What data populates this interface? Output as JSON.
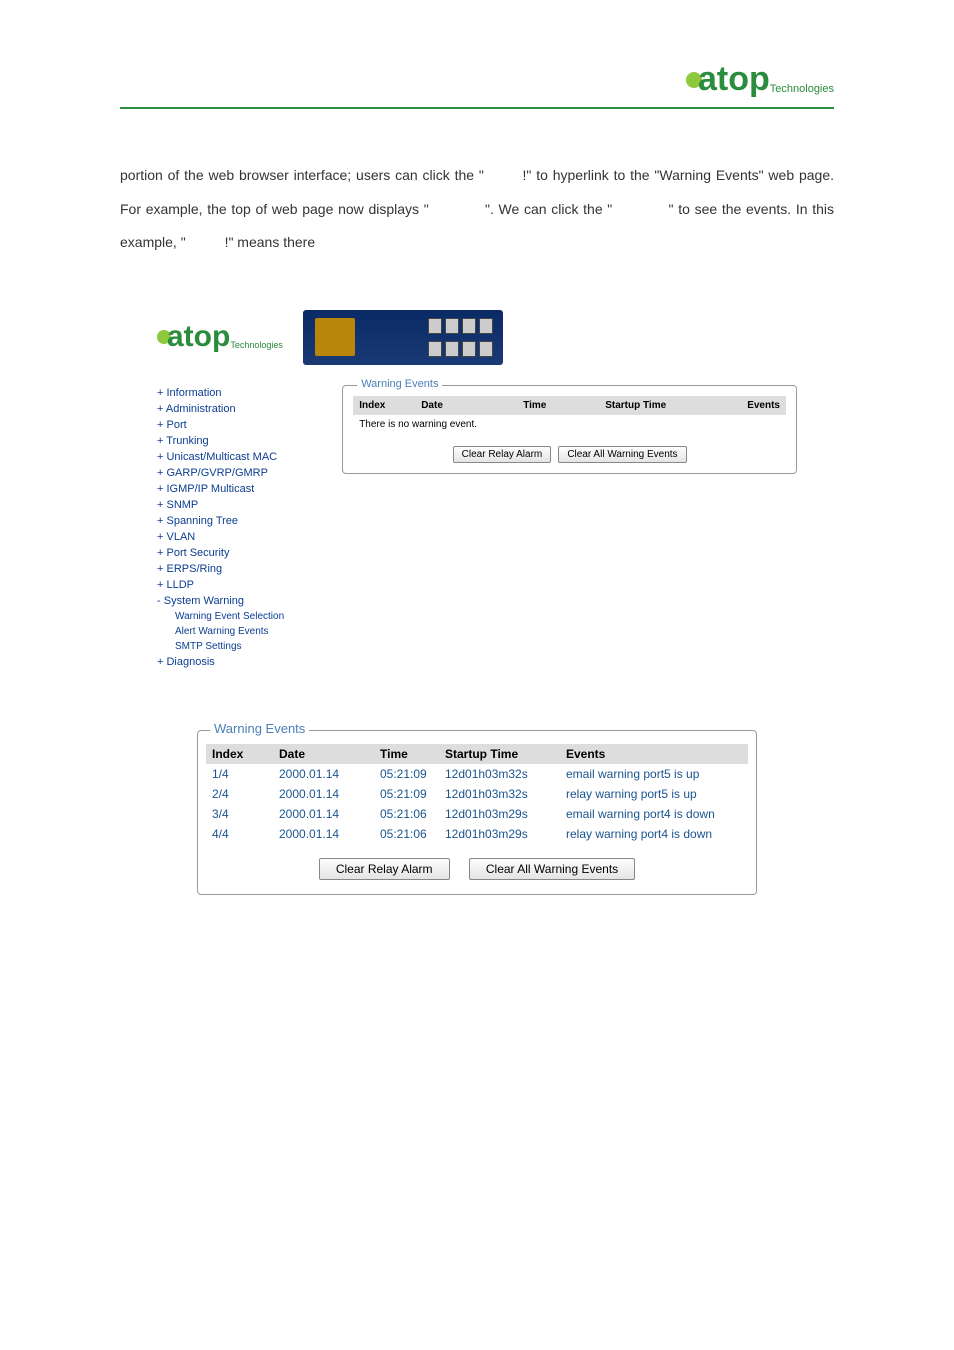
{
  "header": {
    "logo_text": "atop",
    "logo_sub": "Technologies"
  },
  "body_text": "portion of the web browser interface; users can click the \"        !\" to hyperlink to the \"Warning Events\" web page. For example, the top of web page now displays \"            \". We can click the \"            \" to see the events. In this example, \"          !\" means there",
  "figure1": {
    "logo_text": "atop",
    "logo_sub": "Technologies",
    "sidebar": [
      {
        "label": "Information",
        "type": "plus"
      },
      {
        "label": "Administration",
        "type": "plus"
      },
      {
        "label": "Port",
        "type": "plus"
      },
      {
        "label": "Trunking",
        "type": "plus"
      },
      {
        "label": "Unicast/Multicast MAC",
        "type": "plus"
      },
      {
        "label": "GARP/GVRP/GMRP",
        "type": "plus"
      },
      {
        "label": "IGMP/IP Multicast",
        "type": "plus"
      },
      {
        "label": "SNMP",
        "type": "plus"
      },
      {
        "label": "Spanning Tree",
        "type": "plus"
      },
      {
        "label": "VLAN",
        "type": "plus"
      },
      {
        "label": "Port Security",
        "type": "plus"
      },
      {
        "label": "ERPS/Ring",
        "type": "plus"
      },
      {
        "label": "LLDP",
        "type": "plus"
      },
      {
        "label": "System Warning",
        "type": "minus"
      }
    ],
    "sub_items": [
      "Warning Event Selection",
      "Alert Warning Events",
      "SMTP Settings"
    ],
    "last_item": {
      "label": "Diagnosis",
      "type": "plus"
    },
    "panel": {
      "legend": "Warning Events",
      "headers": {
        "index": "Index",
        "date": "Date",
        "time": "Time",
        "startup": "Startup Time",
        "events": "Events"
      },
      "no_event": "There is no warning event.",
      "btn_clear_relay": "Clear Relay Alarm",
      "btn_clear_all": "Clear All Warning Events"
    }
  },
  "figure2": {
    "legend": "Warning Events",
    "headers": {
      "index": "Index",
      "date": "Date",
      "time": "Time",
      "startup": "Startup Time",
      "events": "Events"
    },
    "rows": [
      {
        "index": "1/4",
        "date": "2000.01.14",
        "time": "05:21:09",
        "startup": "12d01h03m32s",
        "events": "email warning port5 is up"
      },
      {
        "index": "2/4",
        "date": "2000.01.14",
        "time": "05:21:09",
        "startup": "12d01h03m32s",
        "events": "relay warning port5 is up"
      },
      {
        "index": "3/4",
        "date": "2000.01.14",
        "time": "05:21:06",
        "startup": "12d01h03m29s",
        "events": "email warning port4 is down"
      },
      {
        "index": "4/4",
        "date": "2000.01.14",
        "time": "05:21:06",
        "startup": "12d01h03m29s",
        "events": "relay warning port4 is down"
      }
    ],
    "btn_clear_relay": "Clear Relay Alarm",
    "btn_clear_all": "Clear All Warning Events"
  }
}
